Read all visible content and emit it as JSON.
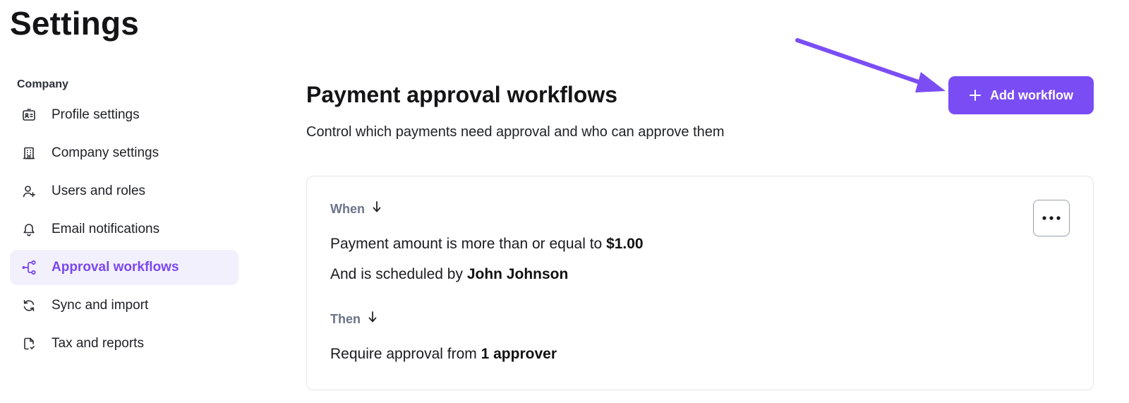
{
  "page": {
    "title": "Settings"
  },
  "sidebar": {
    "section_label": "Company",
    "items": [
      {
        "label": "Profile settings",
        "icon": "id-card-icon",
        "active": false
      },
      {
        "label": "Company settings",
        "icon": "building-icon",
        "active": false
      },
      {
        "label": "Users and roles",
        "icon": "user-plus-icon",
        "active": false
      },
      {
        "label": "Email notifications",
        "icon": "bell-icon",
        "active": false
      },
      {
        "label": "Approval workflows",
        "icon": "workflow-icon",
        "active": true
      },
      {
        "label": "Sync and import",
        "icon": "sync-icon",
        "active": false
      },
      {
        "label": "Tax and reports",
        "icon": "document-icon",
        "active": false
      }
    ]
  },
  "main": {
    "title": "Payment approval workflows",
    "subtitle": "Control which payments need approval and who can approve them",
    "add_button": {
      "label": "Add workflow",
      "icon": "plus-icon"
    },
    "workflow": {
      "when_label": "When",
      "condition_amount_text": "Payment amount is more than or equal to",
      "condition_amount_value": "$1.00",
      "condition_scheduler_text": "And is scheduled by",
      "condition_scheduler_value": "John Johnson",
      "then_label": "Then",
      "action_text": "Require approval from",
      "action_value": "1 approver",
      "more_icon": "more-horizontal-icon"
    }
  },
  "colors": {
    "accent": "#7a4cf4",
    "active_bg": "#f3f0fe",
    "annotation_arrow": "#7b4ef5",
    "step_label": "#6c7488"
  }
}
